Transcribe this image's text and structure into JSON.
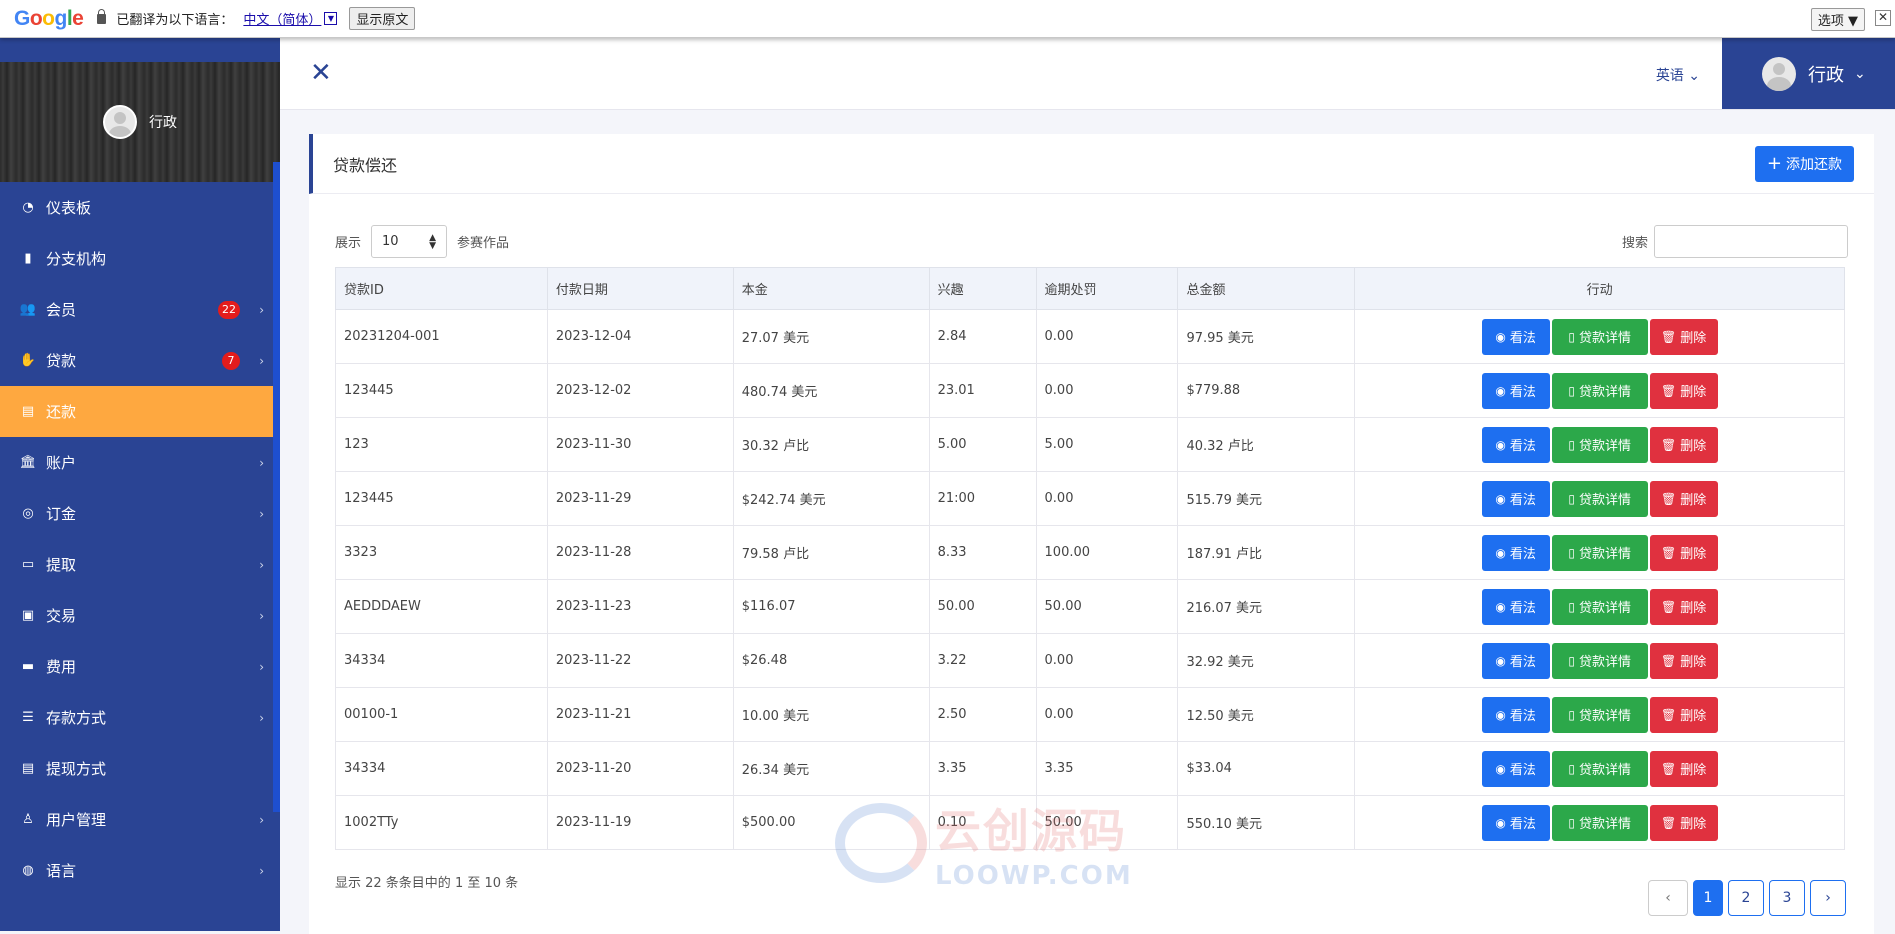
{
  "translate_bar": {
    "logo_letters": [
      "G",
      "o",
      "o",
      "g",
      "l",
      "e"
    ],
    "message": "已翻译为以下语言：",
    "language": "中文（简体）",
    "dropdown_glyph": "▼",
    "show_original": "显示原文",
    "options": "选项 ▼",
    "close": "✕"
  },
  "sidebar": {
    "user_name": "行政",
    "items": [
      {
        "label": "仪表板",
        "icon": "gauge-icon",
        "glyph": "◔",
        "badge": "",
        "chevron": ""
      },
      {
        "label": "分支机构",
        "icon": "building-icon",
        "glyph": "▮",
        "badge": "",
        "chevron": ""
      },
      {
        "label": "会员",
        "icon": "users-icon",
        "glyph": "👥",
        "badge": "22",
        "chevron": "›"
      },
      {
        "label": "贷款",
        "icon": "hand-holding-icon",
        "glyph": "✋",
        "badge": "7",
        "chevron": "›"
      },
      {
        "label": "还款",
        "icon": "receipt-icon",
        "glyph": "▤",
        "badge": "",
        "chevron": ""
      },
      {
        "label": "账户",
        "icon": "bank-icon",
        "glyph": "🏛",
        "badge": "",
        "chevron": "›"
      },
      {
        "label": "订金",
        "icon": "coins-icon",
        "glyph": "◎",
        "badge": "",
        "chevron": "›"
      },
      {
        "label": "提取",
        "icon": "credit-card-icon",
        "glyph": "▭",
        "badge": "",
        "chevron": "›"
      },
      {
        "label": "交易",
        "icon": "wallet-icon",
        "glyph": "▣",
        "badge": "",
        "chevron": "›"
      },
      {
        "label": "费用",
        "icon": "money-bill-icon",
        "glyph": "▬",
        "badge": "",
        "chevron": "›"
      },
      {
        "label": "存款方式",
        "icon": "list-icon",
        "glyph": "☰",
        "badge": "",
        "chevron": "›"
      },
      {
        "label": "提现方式",
        "icon": "clipboard-icon",
        "glyph": "▤",
        "badge": "",
        "chevron": ""
      },
      {
        "label": "用户管理",
        "icon": "user-icon",
        "glyph": "♙",
        "badge": "",
        "chevron": "›"
      },
      {
        "label": "语言",
        "icon": "globe-icon",
        "glyph": "◍",
        "badge": "",
        "chevron": "›"
      }
    ],
    "active_index": 4
  },
  "topbar": {
    "close_glyph": "✕",
    "language": "英语",
    "lang_chevron": "⌄",
    "user_name": "行政",
    "user_chevron": "⌄"
  },
  "card": {
    "title": "贷款偿还",
    "add_label": "添加还款",
    "add_glyph": "+",
    "show_label": "展示",
    "page_size": "10",
    "entries_label": "参赛作品",
    "search_label": "搜索",
    "search_value": "",
    "columns": [
      "贷款ID",
      "付款日期",
      "本金",
      "兴趣",
      "逾期处罚",
      "总金额",
      "行动"
    ],
    "rows": [
      [
        "20231204-001",
        "2023-12-04",
        "27.07 美元",
        "2.84",
        "0.00",
        "97.95 美元"
      ],
      [
        "123445",
        "2023-12-02",
        "480.74 美元",
        "23.01",
        "0.00",
        "$779.88"
      ],
      [
        "123",
        "2023-11-30",
        "30.32 卢比",
        "5.00",
        "5.00",
        "40.32 卢比"
      ],
      [
        "123445",
        "2023-11-29",
        "$242.74 美元",
        "21:00",
        "0.00",
        "515.79 美元"
      ],
      [
        "3323",
        "2023-11-28",
        "79.58 卢比",
        "8.33",
        "100.00",
        "187.91 卢比"
      ],
      [
        "AEDDDAEW",
        "2023-11-23",
        "$116.07",
        "50.00",
        "50.00",
        "216.07 美元"
      ],
      [
        "34334",
        "2023-11-22",
        "$26.48",
        "3.22",
        "0.00",
        "32.92 美元"
      ],
      [
        "00100-1",
        "2023-11-21",
        "10.00 美元",
        "2.50",
        "0.00",
        "12.50 美元"
      ],
      [
        "34334",
        "2023-11-20",
        "26.34 美元",
        "3.35",
        "3.35",
        "$33.04"
      ],
      [
        "1002TTy",
        "2023-11-19",
        "$500.00",
        "0.10",
        "50.00",
        "550.10 美元"
      ]
    ],
    "actions": {
      "view": "看法",
      "detail": "贷款详情",
      "delete": "删除"
    },
    "info": "显示 22 条条目中的 1 至 10 条",
    "pages": [
      "1",
      "2",
      "3"
    ],
    "current_page": "1",
    "prev_glyph": "‹",
    "next_glyph": "›"
  },
  "watermark": {
    "cn": "云创源码",
    "en": "LOOWP.COM"
  },
  "colors": {
    "sidebar": "#2a4494",
    "active": "#fea840",
    "primary": "#1e6ff0",
    "success": "#2ca84a",
    "danger": "#e0313f"
  }
}
